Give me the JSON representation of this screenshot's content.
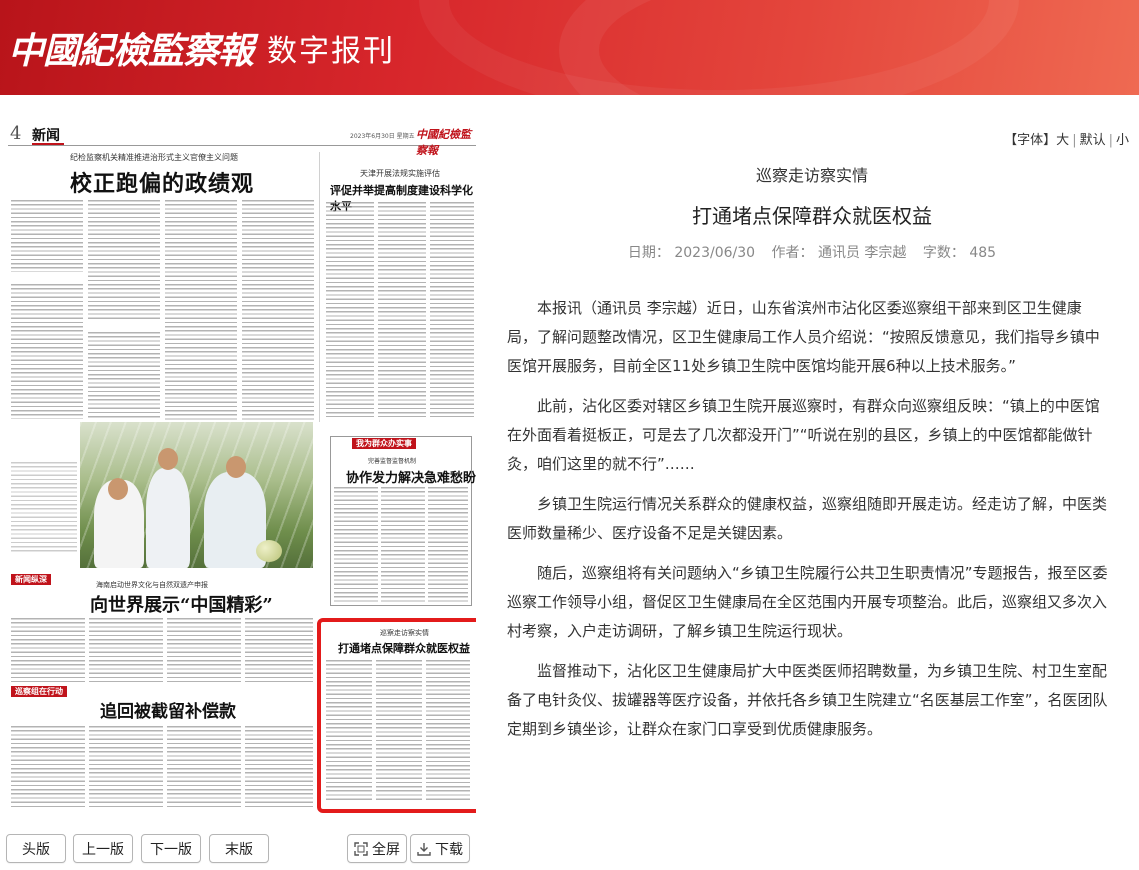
{
  "header": {
    "brand": "中國紀檢監察報",
    "subtitle": "数字报刊"
  },
  "paper": {
    "page_number": "4",
    "section": "新闻",
    "date_line": "2023年6月30日  星期五",
    "masthead": "中國紀檢監察報",
    "story1_kicker": "纪检监察机关精准推进治形式主义官僚主义问题",
    "story1_title": "校正跑偏的政绩观",
    "story2_kicker": "天津开展法规实施评估",
    "story2_title": "评促并举提高制度建设科学化水平",
    "story3_tag": "我为群众办实事",
    "story3_kicker": "完善监督监督机制",
    "story3_title": "协作发力解决急难愁盼",
    "story4_kicker": "海南启动世界文化与自然双遗产申报",
    "story4_title": "向世界展示“中国精彩”",
    "story5_title": "追回被截留补偿款",
    "story6_kicker": "巡察走访察实情",
    "story6_title": "打通堵点保障群众就医权益",
    "tag_news": "新闻纵深",
    "tag_patrol": "巡察组在行动"
  },
  "pager": {
    "first": "头版",
    "prev": "上一版",
    "next": "下一版",
    "last": "末版",
    "fullscreen": "全屏",
    "download": "下载"
  },
  "font_controls": {
    "label": "【字体】",
    "large": "大",
    "default": "默认",
    "small": "小"
  },
  "article": {
    "kicker": "巡察走访察实情",
    "title": "打通堵点保障群众就医权益",
    "date": "日期：  2023/06/30",
    "author": "作者：  通讯员 李宗越",
    "wordcount": "字数：  485",
    "paragraphs": [
      "本报讯（通讯员 李宗越）近日，山东省滨州市沾化区委巡察组干部来到区卫生健康局，了解问题整改情况，区卫生健康局工作人员介绍说：“按照反馈意见，我们指导乡镇中医馆开展服务，目前全区11处乡镇卫生院中医馆均能开展6种以上技术服务。”",
      "此前，沾化区委对辖区乡镇卫生院开展巡察时，有群众向巡察组反映：“镇上的中医馆在外面看着挺板正，可是去了几次都没开门”“听说在别的县区，乡镇上的中医馆都能做针灸，咱们这里的就不行”……",
      "乡镇卫生院运行情况关系群众的健康权益，巡察组随即开展走访。经走访了解，中医类医师数量稀少、医疗设备不足是关键因素。",
      "随后，巡察组将有关问题纳入“乡镇卫生院履行公共卫生职责情况”专题报告，报至区委巡察工作领导小组，督促区卫生健康局在全区范围内开展专项整治。此后，巡察组又多次入村考察，入户走访调研，了解乡镇卫生院运行现状。",
      "监督推动下，沾化区卫生健康局扩大中医类医师招聘数量，为乡镇卫生院、村卫生室配备了电针灸仪、拔罐器等医疗设备，并依托各乡镇卫生院建立“名医基层工作室”，名医团队定期到乡镇坐诊，让群众在家门口享受到优质健康服务。"
    ]
  },
  "colors": {
    "header_red": "#d7262b",
    "highlight_red": "#e31b1b"
  }
}
